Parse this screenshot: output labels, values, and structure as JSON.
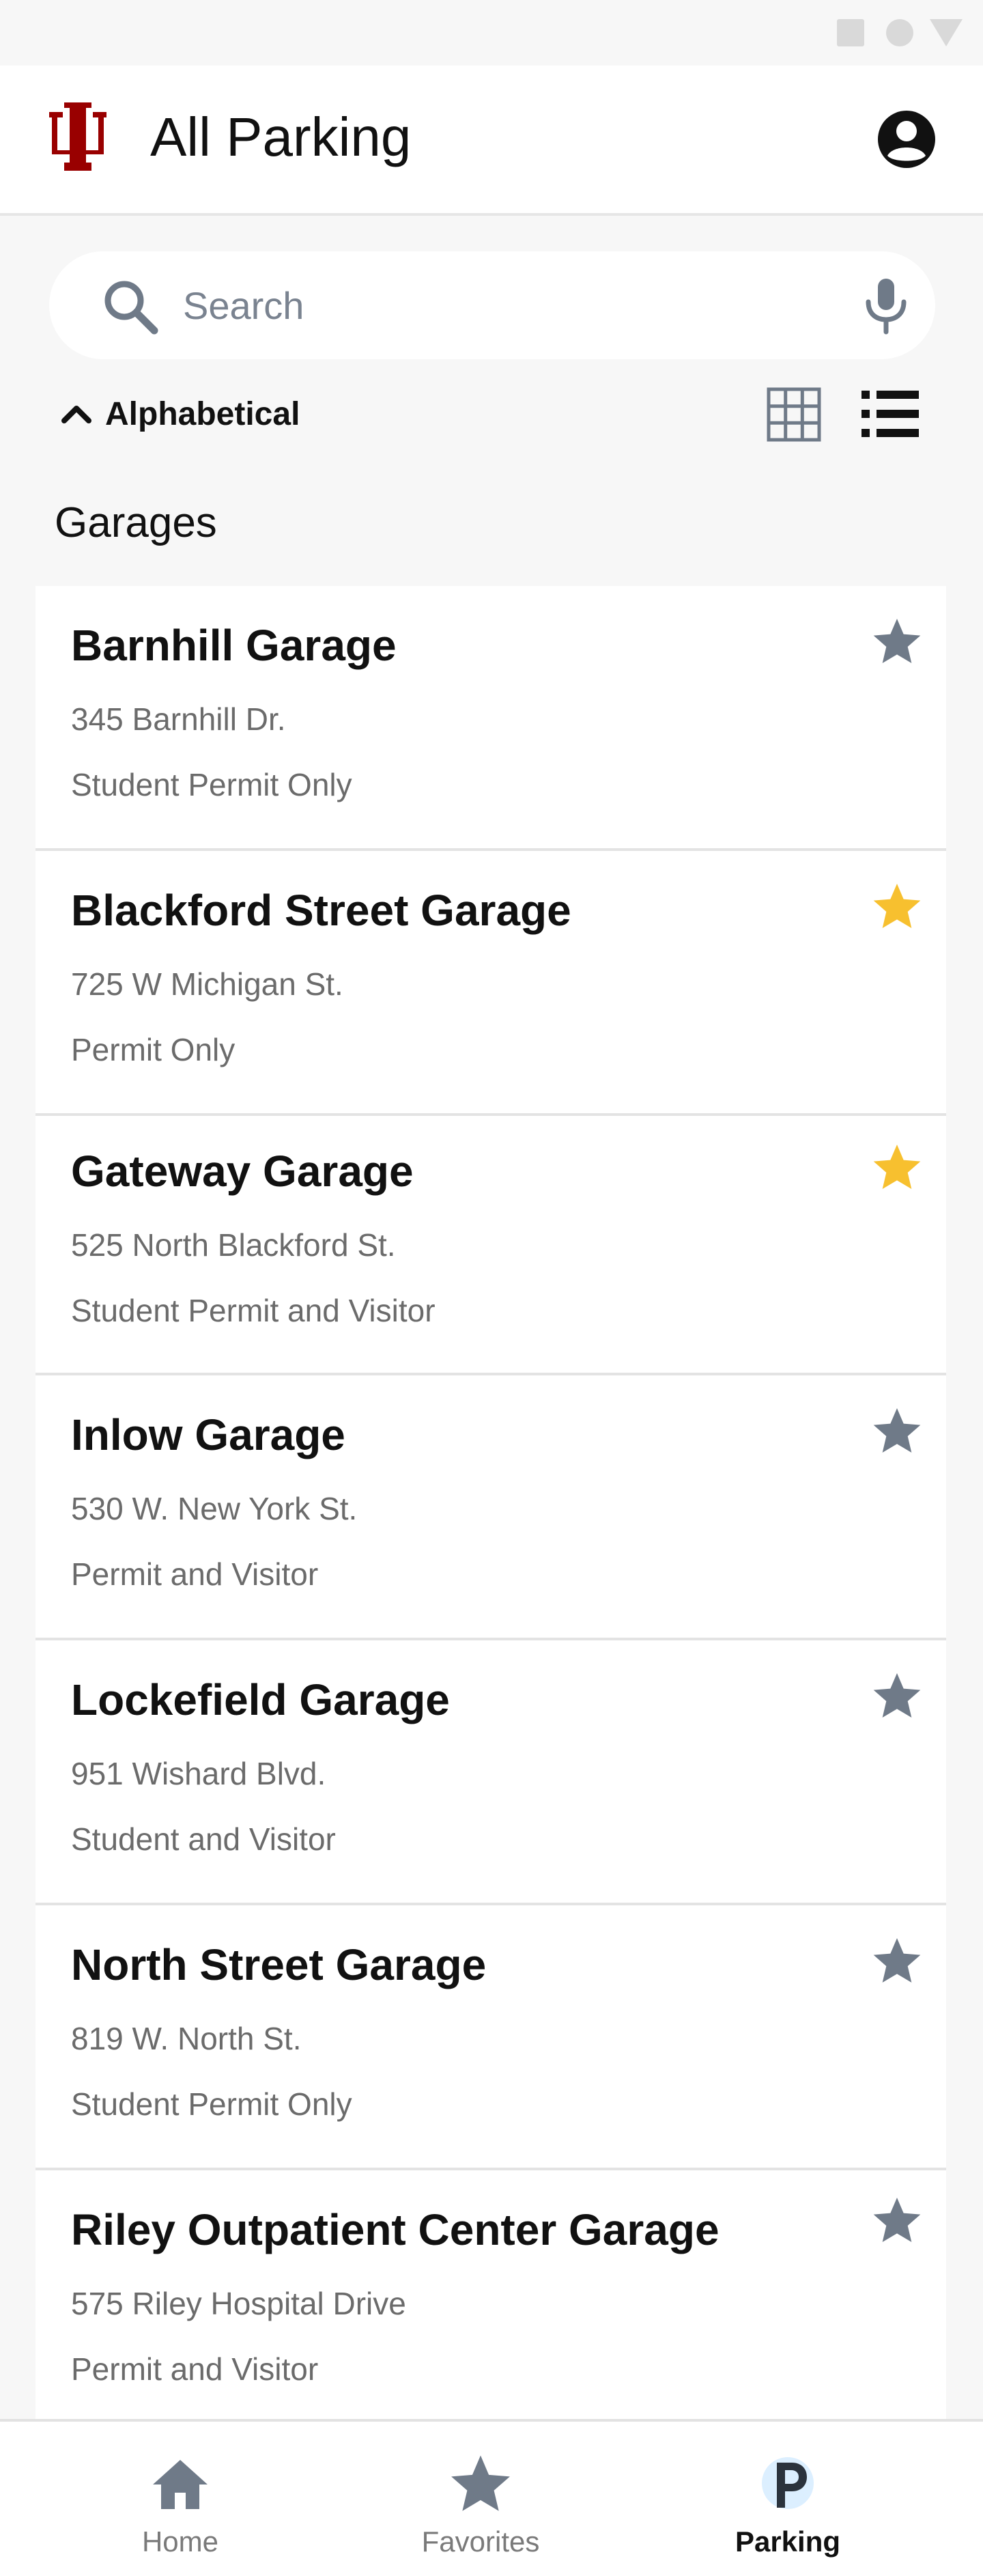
{
  "app_bar": {
    "title": "All Parking",
    "brand_color": "#990000"
  },
  "search": {
    "placeholder": "Search",
    "value": ""
  },
  "sort": {
    "label": "Alphabetical",
    "direction": "ascending"
  },
  "view": {
    "grid_icon": "grid-view-icon",
    "list_icon": "list-view-icon",
    "active": "list"
  },
  "section": {
    "title": "Garages"
  },
  "garages": [
    {
      "name": "Barnhill Garage",
      "address": "345 Barnhill Dr.",
      "permit": "Student Permit Only",
      "favorite": false
    },
    {
      "name": "Blackford Street Garage",
      "address": "725 W Michigan St.",
      "permit": "Permit Only",
      "favorite": true
    },
    {
      "name": "Gateway Garage",
      "address": "525 North Blackford St.",
      "permit": "Student Permit and Visitor",
      "favorite": true
    },
    {
      "name": "Inlow Garage",
      "address": "530 W. New York St.",
      "permit": "Permit and Visitor",
      "favorite": false
    },
    {
      "name": "Lockefield Garage",
      "address": "951 Wishard Blvd.",
      "permit": "Student and Visitor",
      "favorite": false
    },
    {
      "name": "North Street Garage",
      "address": "819 W. North St.",
      "permit": "Student Permit Only",
      "favorite": false
    },
    {
      "name": "Riley Outpatient Center Garage",
      "address": "575 Riley Hospital Drive",
      "permit": "Permit and Visitor",
      "favorite": false
    }
  ],
  "colors": {
    "star_favorite": "#f7c02f",
    "star_default": "#6f7a88",
    "nav_icon": "#6f7a88"
  },
  "bottom_nav": {
    "items": [
      {
        "label": "Home",
        "icon": "home-icon",
        "active": false
      },
      {
        "label": "Favorites",
        "icon": "star-icon",
        "active": false
      },
      {
        "label": "Parking",
        "icon": "parking-icon",
        "active": true
      }
    ]
  }
}
